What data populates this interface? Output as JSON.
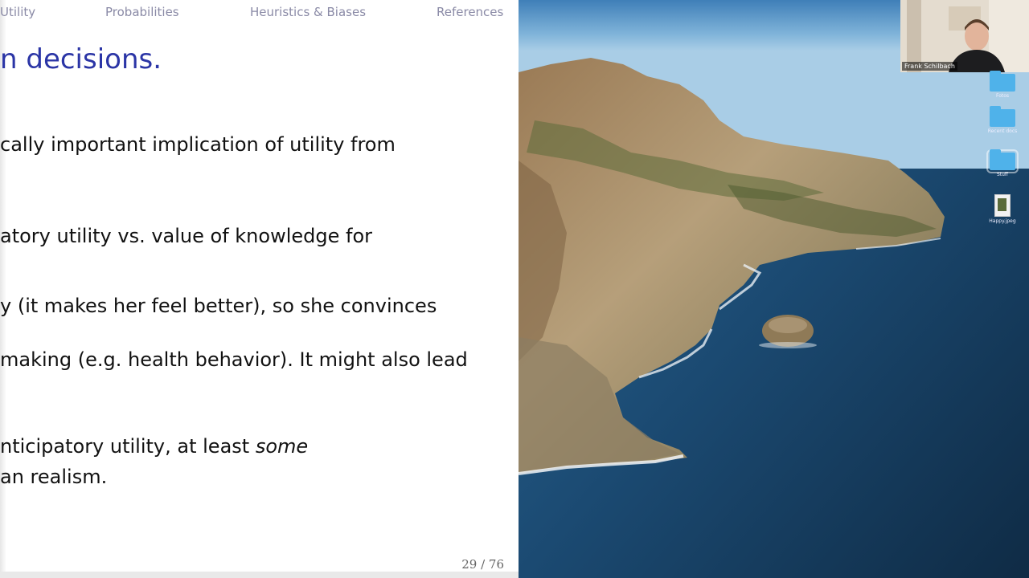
{
  "slide": {
    "nav": [
      "Utility",
      "Probabilities",
      "Heuristics & Biases",
      "References"
    ],
    "title": "n decisions.",
    "lines": [
      "cally important implication of utility from",
      "atory utility vs. value of knowledge for",
      "y (it makes her feel better), so she convinces",
      "making (e.g. health behavior).  It might also lead",
      "nticipatory utility, at least some",
      "an realism."
    ],
    "page_number": "29 / 76"
  },
  "video": {
    "participant_name": "Frank Schilbach"
  },
  "desktop_icons": [
    {
      "label": "Fotos",
      "icon": "folder-icon"
    },
    {
      "label": "Recent docs",
      "icon": "folder-icon"
    },
    {
      "label": "Stuff",
      "icon": "folder-icon"
    },
    {
      "label": "Happy.jpeg",
      "icon": "image-file-icon"
    }
  ]
}
